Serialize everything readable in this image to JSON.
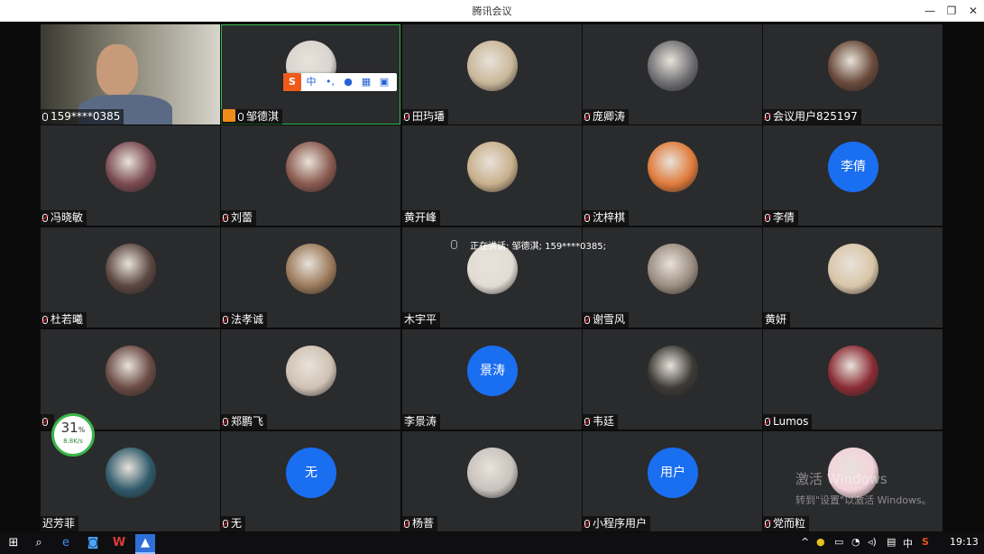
{
  "window": {
    "title": "腾讯会议",
    "minimize": "—",
    "restore": "❐",
    "close": "✕"
  },
  "participants": [
    {
      "name": "159****0385",
      "mic": "on",
      "avatar": {
        "kind": "video",
        "color": "#8d8a7a"
      }
    },
    {
      "name": "邹德淇",
      "mic": "on",
      "host": true,
      "active": true,
      "avatar": {
        "kind": "photo",
        "color": "#d9d4cf"
      }
    },
    {
      "name": "田玙璠",
      "mic": "muted",
      "avatar": {
        "kind": "photo",
        "color": "#c9b79a"
      }
    },
    {
      "name": "庞卿涛",
      "mic": "muted",
      "avatar": {
        "kind": "photo",
        "color": "#6f6f72"
      }
    },
    {
      "name": "会议用户825197",
      "mic": "muted",
      "avatar": {
        "kind": "photo",
        "color": "#6a4a3a"
      }
    },
    {
      "name": "冯晓敏",
      "mic": "muted",
      "avatar": {
        "kind": "photo",
        "color": "#7a4a52"
      }
    },
    {
      "name": "刘蕾",
      "mic": "muted",
      "avatar": {
        "kind": "photo",
        "color": "#8a5a4e"
      }
    },
    {
      "name": "黄开峰",
      "mic": "none",
      "avatar": {
        "kind": "photo",
        "color": "#c8b08c"
      }
    },
    {
      "name": "沈梓棋",
      "mic": "muted",
      "avatar": {
        "kind": "photo",
        "color": "#e07a3a"
      }
    },
    {
      "name": "李倩",
      "mic": "muted",
      "avatar": {
        "kind": "text",
        "text": "李倩"
      }
    },
    {
      "name": "杜若曦",
      "mic": "muted",
      "avatar": {
        "kind": "photo",
        "color": "#5b4640"
      }
    },
    {
      "name": "法孝诚",
      "mic": "muted",
      "avatar": {
        "kind": "photo",
        "color": "#9b7a5a"
      }
    },
    {
      "name": "木宇平",
      "mic": "none",
      "avatar": {
        "kind": "photo",
        "color": "#e2dcd4"
      }
    },
    {
      "name": "谢雪风",
      "mic": "muted",
      "avatar": {
        "kind": "photo",
        "color": "#9a8c80"
      }
    },
    {
      "name": "黄妍",
      "mic": "none",
      "avatar": {
        "kind": "photo",
        "color": "#d9c6a8"
      }
    },
    {
      "name": "",
      "mic": "muted",
      "avatar": {
        "kind": "photo",
        "color": "#6a4a44"
      }
    },
    {
      "name": "郑鹏飞",
      "mic": "muted",
      "avatar": {
        "kind": "photo",
        "color": "#cfc2b4"
      }
    },
    {
      "name": "李景涛",
      "mic": "none",
      "avatar": {
        "kind": "text",
        "text": "景涛"
      }
    },
    {
      "name": "韦廷",
      "mic": "muted",
      "avatar": {
        "kind": "photo",
        "color": "#3c3a36"
      }
    },
    {
      "name": "Lumos",
      "mic": "muted",
      "avatar": {
        "kind": "photo",
        "color": "#8a2b34"
      }
    },
    {
      "name": "迟芳菲",
      "mic": "none",
      "avatar": {
        "kind": "photo",
        "color": "#2f5a6a"
      }
    },
    {
      "name": "无",
      "mic": "muted",
      "avatar": {
        "kind": "text",
        "text": "无"
      }
    },
    {
      "name": "杨萻",
      "mic": "muted",
      "avatar": {
        "kind": "photo",
        "color": "#c9c2bd"
      }
    },
    {
      "name": "小程序用户",
      "mic": "muted",
      "avatar": {
        "kind": "text",
        "text": "用户"
      }
    },
    {
      "name": "党而粒",
      "mic": "muted",
      "avatar": {
        "kind": "photo",
        "color": "#f3d3dc"
      }
    }
  ],
  "ime_toolbar": {
    "logo": "S",
    "lang": "中",
    "punct": "•,",
    "voice": "mic-icon",
    "keyboard": "keyboard-icon",
    "more": "grid-icon"
  },
  "speaking": {
    "text": "正在讲话: 邹德淇; 159****0385;"
  },
  "net_gauge": {
    "percent": "31",
    "unit": "%",
    "speed": "8.8K/s"
  },
  "watermark": {
    "line1": "激活 Windows",
    "line2": "转到\"设置\"以激活 Windows。"
  },
  "taskbar": {
    "time": "19:13",
    "ime": "中"
  }
}
